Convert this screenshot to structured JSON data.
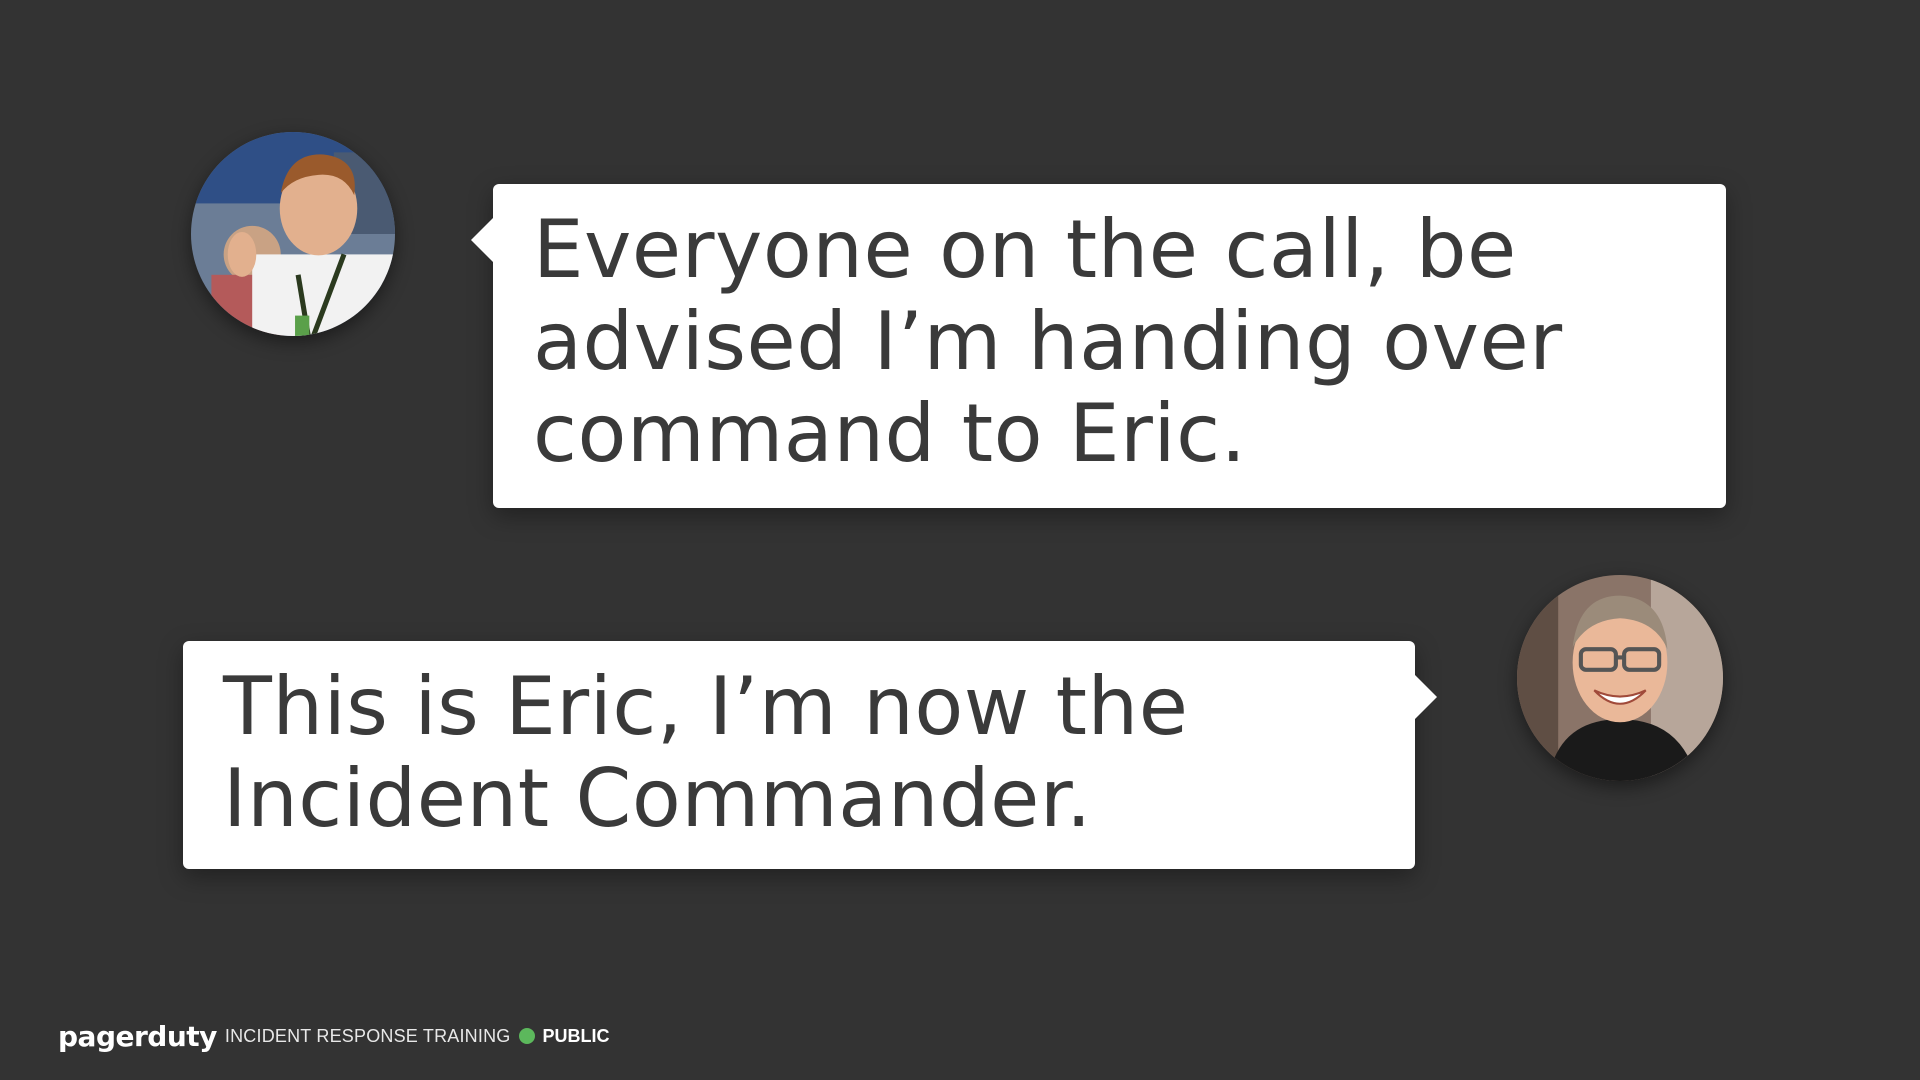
{
  "messages": [
    {
      "speaker_avatar": "person-with-lanyard-avatar",
      "text": "Everyone on the call, be advised I’m handing over command to Eric."
    },
    {
      "speaker_avatar": "smiling-man-with-glasses-avatar",
      "text": "This is Eric, I’m now the Incident Commander."
    }
  ],
  "footer": {
    "brand": "pagerduty",
    "label": "INCIDENT RESPONSE TRAINING",
    "status": "PUBLIC",
    "status_color": "#5cb85c"
  },
  "colors": {
    "background": "#333333",
    "bubble": "#ffffff",
    "text": "#3a3a3a"
  }
}
